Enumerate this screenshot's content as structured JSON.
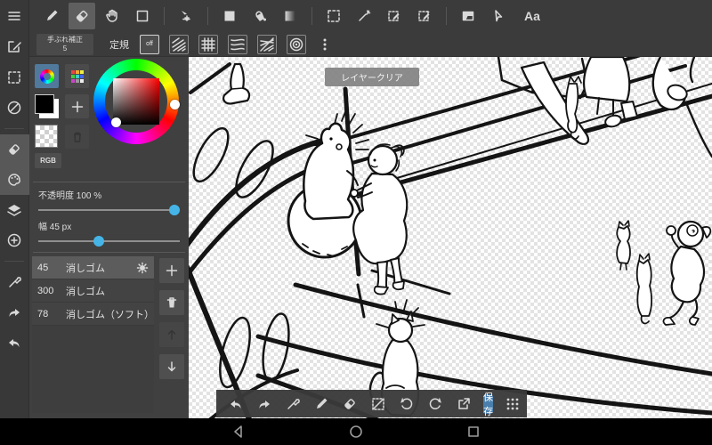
{
  "topbar": {
    "text_tool_label": "Aa"
  },
  "toolbar2": {
    "stabilizer_label": "手ぶれ補正",
    "stabilizer_value": "5",
    "ruler_label": "定規",
    "ruler_off_label": "off"
  },
  "color_panel": {
    "rgb_label": "RGB",
    "opacity_label": "不透明度 100 %",
    "opacity_value": 100,
    "width_label": "幅 45 px",
    "width_value": 45
  },
  "brush_list": {
    "items": [
      {
        "size": "45",
        "name": "消しゴム",
        "selected": true
      },
      {
        "size": "300",
        "name": "消しゴム",
        "selected": false
      },
      {
        "size": "78",
        "name": "消しゴム（ソフト）",
        "selected": false
      }
    ]
  },
  "canvas": {
    "toast": "レイヤークリア",
    "save_label": "保存"
  },
  "colors": {
    "accent_blue": "#45b5e8",
    "save_blue": "#4a7fad",
    "toolbar_gray": "#3b3b3b",
    "selection_gray": "#5f5f5f",
    "canvas_checker": "#e3e3e3"
  }
}
